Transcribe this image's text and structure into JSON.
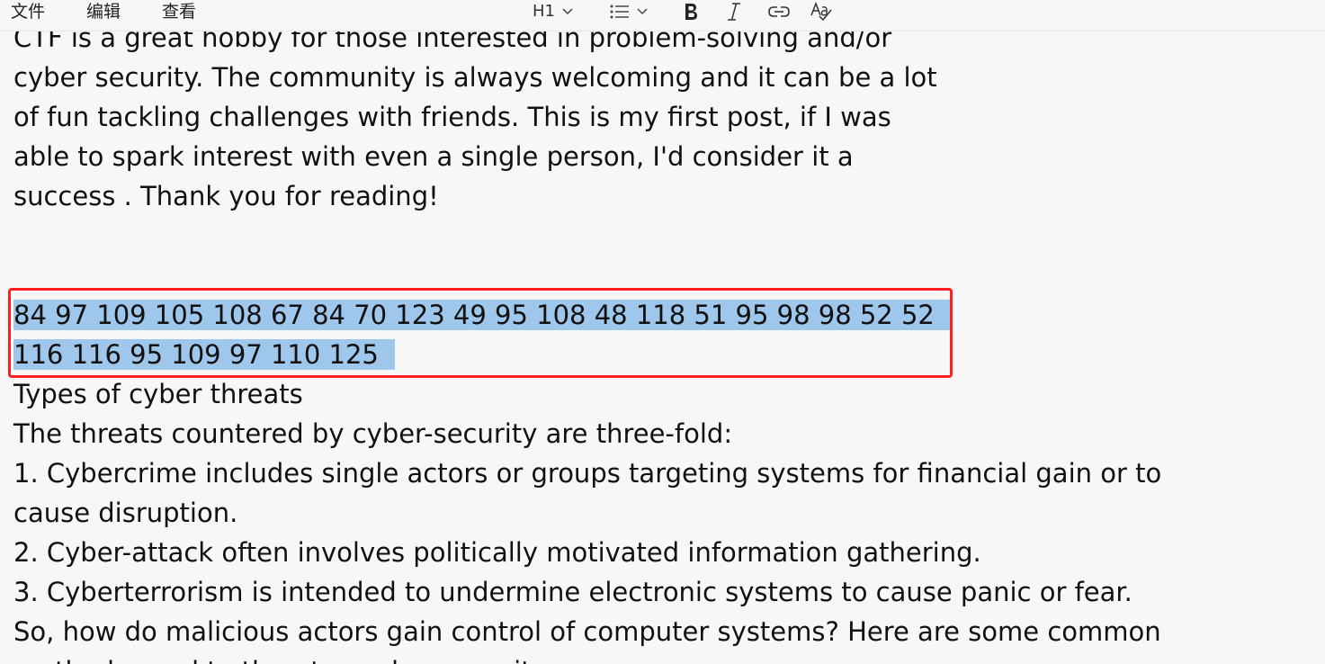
{
  "menu": {
    "file": "文件",
    "edit": "编辑",
    "view": "查看"
  },
  "toolbar": {
    "heading_label": "H1",
    "icons": [
      "list-icon",
      "bold-icon",
      "italic-icon",
      "link-icon",
      "spellcheck-icon"
    ]
  },
  "document": {
    "paragraph_lines": [
      "CTF is a great hobby for those interested in problem-solving and/or",
      "cyber security. The community is always welcoming and it can be a lot",
      "of fun tackling challenges with friends. This is my first post, if I was",
      "able to spark interest with even a single person, I'd consider it a",
      "success . Thank you for reading!"
    ],
    "selected_lines": [
      "84 97 109 105 108 67 84 70 123 49 95 108 48 118 51 95 98 98 52 52",
      "116 116 95 109 97 110 125"
    ],
    "after_lines": [
      "Types of cyber threats",
      "The threats countered by cyber-security are three-fold:",
      "1. Cybercrime includes single actors or groups targeting systems for financial gain or to",
      "cause disruption.",
      "2. Cyber-attack often involves politically motivated information gathering.",
      "3. Cyberterrorism is intended to undermine electronic systems to cause panic or fear.",
      "So, how do malicious actors gain control of computer systems? Here are some common",
      "methods used to threaten cyber-security:"
    ]
  },
  "colors": {
    "selection": "#9fc7ec",
    "highlight_border": "#ff1f1f",
    "background": "#f7f7f7"
  }
}
